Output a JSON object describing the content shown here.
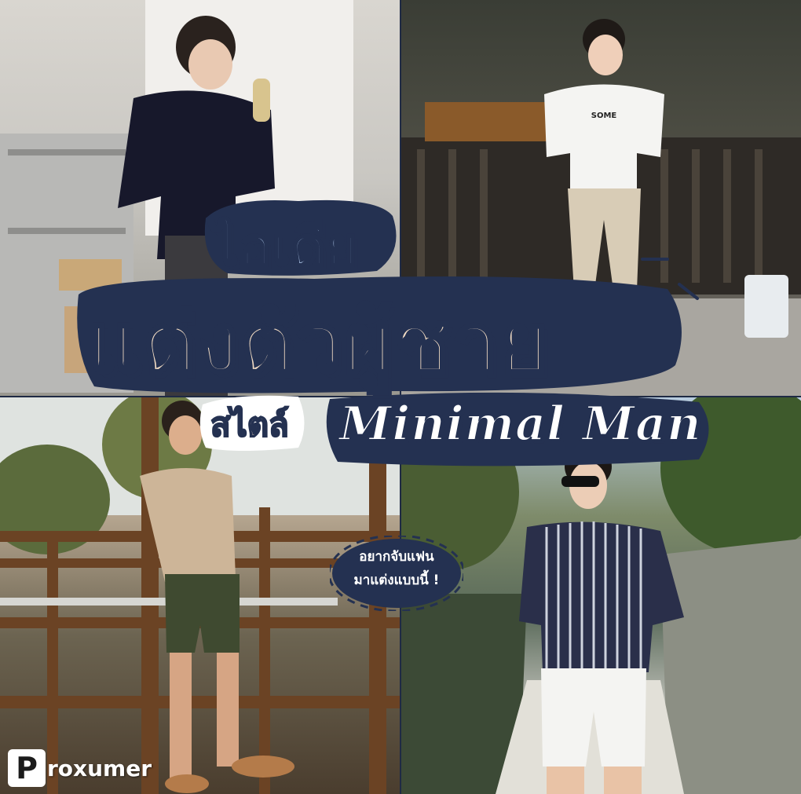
{
  "title": {
    "line1": "ไอเดีย",
    "line2": "แต่งตัวผู้ชาย",
    "line3_thai": "สไตล์",
    "line3_en": "Minimal Man"
  },
  "bubble": {
    "line1": "อยากจับแฟน",
    "line2": "มาแต่งแบบนี้ !"
  },
  "shirt_print": "SOME",
  "logo": {
    "letter": "P",
    "text": "roxumer"
  },
  "colors": {
    "navy": "#243151",
    "cream": "#f2dcc4",
    "light_blue": "#9fb6d8"
  }
}
